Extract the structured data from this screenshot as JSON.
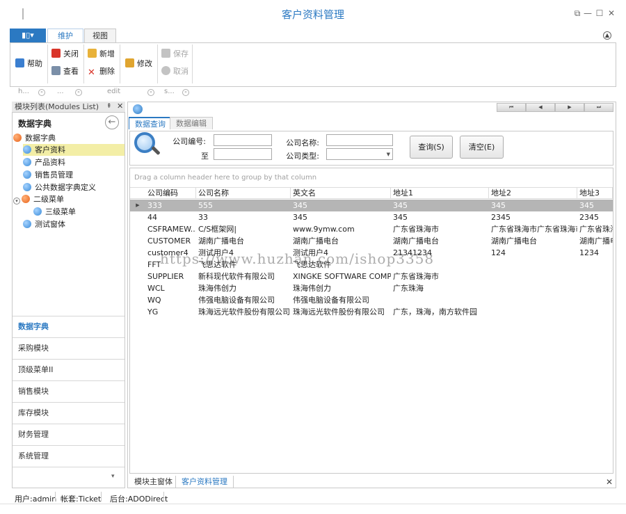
{
  "window": {
    "title": "客户资料管理",
    "controls": [
      "⧉",
      "—",
      "☐",
      "✕"
    ]
  },
  "ribbon": {
    "app_menu_label": "▮▯▾",
    "tabs": [
      {
        "label": "维护"
      },
      {
        "label": "视图"
      }
    ],
    "buttons": {
      "help": "帮助",
      "close": "关闭",
      "view": "查看",
      "new": "新增",
      "delete": "删除",
      "modify": "修改",
      "save": "保存",
      "cancel": "取消"
    },
    "group_labels": [
      "h...",
      "...",
      "edit",
      "s..."
    ]
  },
  "left_panel": {
    "header": "模块列表(Modules List)",
    "pin": "⇞",
    "close": "✕",
    "group_title": "数据字典",
    "tree": [
      {
        "label": "数据字典"
      },
      {
        "label": "客户资料"
      },
      {
        "label": "产品资料"
      },
      {
        "label": "销售员管理"
      },
      {
        "label": "公共数据字典定义"
      },
      {
        "label": "二级菜单"
      },
      {
        "label": "三级菜单"
      },
      {
        "label": "测试窗体"
      }
    ],
    "nav_groups": [
      "数据字典",
      "采购模块",
      "顶级菜单II",
      "销售模块",
      "库存模块",
      "财务管理",
      "系统管理"
    ]
  },
  "main": {
    "inner_tabs": [
      "数据查询",
      "数据编辑"
    ],
    "pager": [
      "⏮",
      "◀",
      "▶",
      "⏭"
    ],
    "query": {
      "company_code_label": "公司编号:",
      "to_label": "至",
      "company_name_label": "公司名称:",
      "company_type_label": "公司类型:",
      "query_button": "查询(S)",
      "clear_button": "清空(E)"
    },
    "grid": {
      "group_hint": "Drag a column header here to group by that column",
      "columns": [
        "公司编码",
        "公司名称",
        "英文名",
        "地址1",
        "地址2",
        "地址3"
      ],
      "rows": [
        [
          "333",
          "555",
          "345",
          "345",
          "345",
          "345"
        ],
        [
          "44",
          "33",
          "345",
          "345",
          "2345",
          "2345"
        ],
        [
          "CSFRAMEW...",
          "C/S框架网|",
          "www.9ymw.com",
          "广东省珠海市",
          "广东省珠海市广东省珠海市",
          "广东省珠海"
        ],
        [
          "CUSTOMER",
          "湖南广播电台",
          "湖南广播电台",
          "湖南广播电台",
          "湖南广播电台",
          "湖南广播电"
        ],
        [
          "customer4",
          "测试用户4",
          "测试用户4",
          "21341234",
          "124",
          "1234"
        ],
        [
          "FFT",
          "飞思达软件",
          "飞思达软件",
          "",
          "",
          ""
        ],
        [
          "SUPPLIER",
          "新科现代软件有限公司",
          "XINGKE SOFTWARE COMP...",
          "广东省珠海市",
          "",
          ""
        ],
        [
          "WCL",
          "珠海伟创力",
          "珠海伟创力",
          "广东珠海",
          "",
          ""
        ],
        [
          "WQ",
          "伟强电脑设备有限公司",
          "伟强电脑设备有限公司",
          "",
          "",
          ""
        ],
        [
          "YG",
          "珠海远光软件股份有限公司",
          "珠海远光软件股份有限公司",
          "广东，珠海，南方软件园",
          "",
          ""
        ]
      ]
    },
    "watermark": "https://www.huzhan.com/ishop3358"
  },
  "doc_tabs": [
    "模块主窗体",
    "客户资料管理"
  ],
  "status": {
    "user": "用户:admin",
    "account": "帐套:Ticket",
    "backend": "后台:ADODirect"
  },
  "colors": {
    "accent": "#2b79c2",
    "selected_tree_bg": "#f3eea6",
    "focused_row_bg": "#b5b5b5"
  }
}
